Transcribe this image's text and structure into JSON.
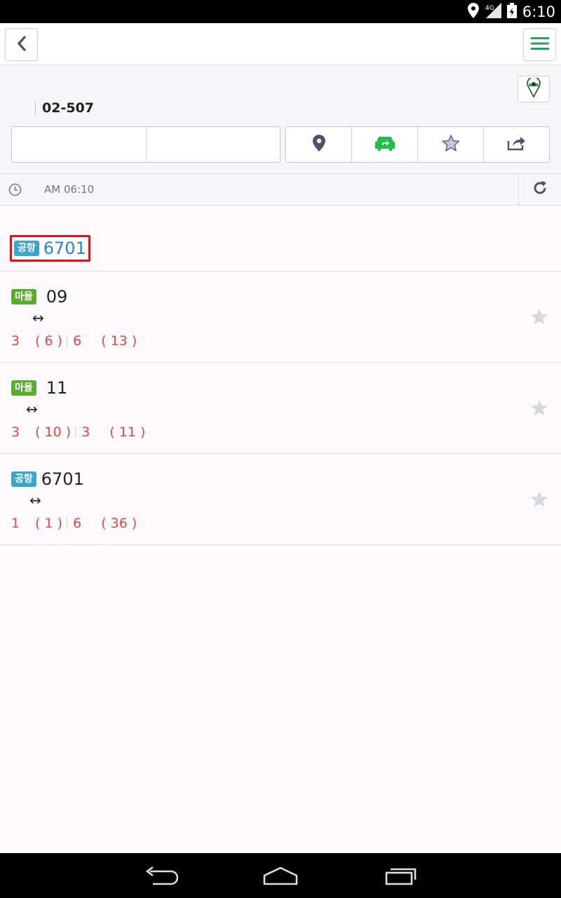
{
  "status_bar": {
    "time": "6:10",
    "network": "4G",
    "icons": [
      "location-icon",
      "signal-icon",
      "battery-icon"
    ]
  },
  "appbar": {
    "back_icon": "chevron-left-icon",
    "menu_icon": "hamburger-menu-icon"
  },
  "stop": {
    "id": "02-507",
    "actions": [
      "location-icon",
      "transfer-icon",
      "star-icon",
      "share-icon"
    ]
  },
  "timebar": {
    "time": "AM 06:10"
  },
  "selected_route": {
    "tag": "공항",
    "number": "6701"
  },
  "routes": [
    {
      "tag": "마을",
      "tag_type": "village",
      "number": "09",
      "arrow": "↔",
      "arrival1_a": "3",
      "arrival1_b": "( 6 )",
      "arrival2_a": "6",
      "arrival2_b": "( 13 )"
    },
    {
      "tag": "마을",
      "tag_type": "village",
      "number": "11",
      "arrow": "↔",
      "arrival1_a": "3",
      "arrival1_b": "( 10 )",
      "arrival2_a": "3",
      "arrival2_b": "( 11 )"
    },
    {
      "tag": "공항",
      "tag_type": "airport",
      "number": "6701",
      "arrow": "↔",
      "arrival1_a": "1",
      "arrival1_b": "( 1 )",
      "arrival2_a": "6",
      "arrival2_b": "( 36 )"
    }
  ],
  "colors": {
    "accent_green": "#2e9e5a",
    "airport_tag": "#3aa7c8",
    "village_tag": "#5aac2c",
    "arrival_red": "#e04848",
    "selection_red": "#e0101c",
    "link_blue": "#2f7fd6"
  }
}
